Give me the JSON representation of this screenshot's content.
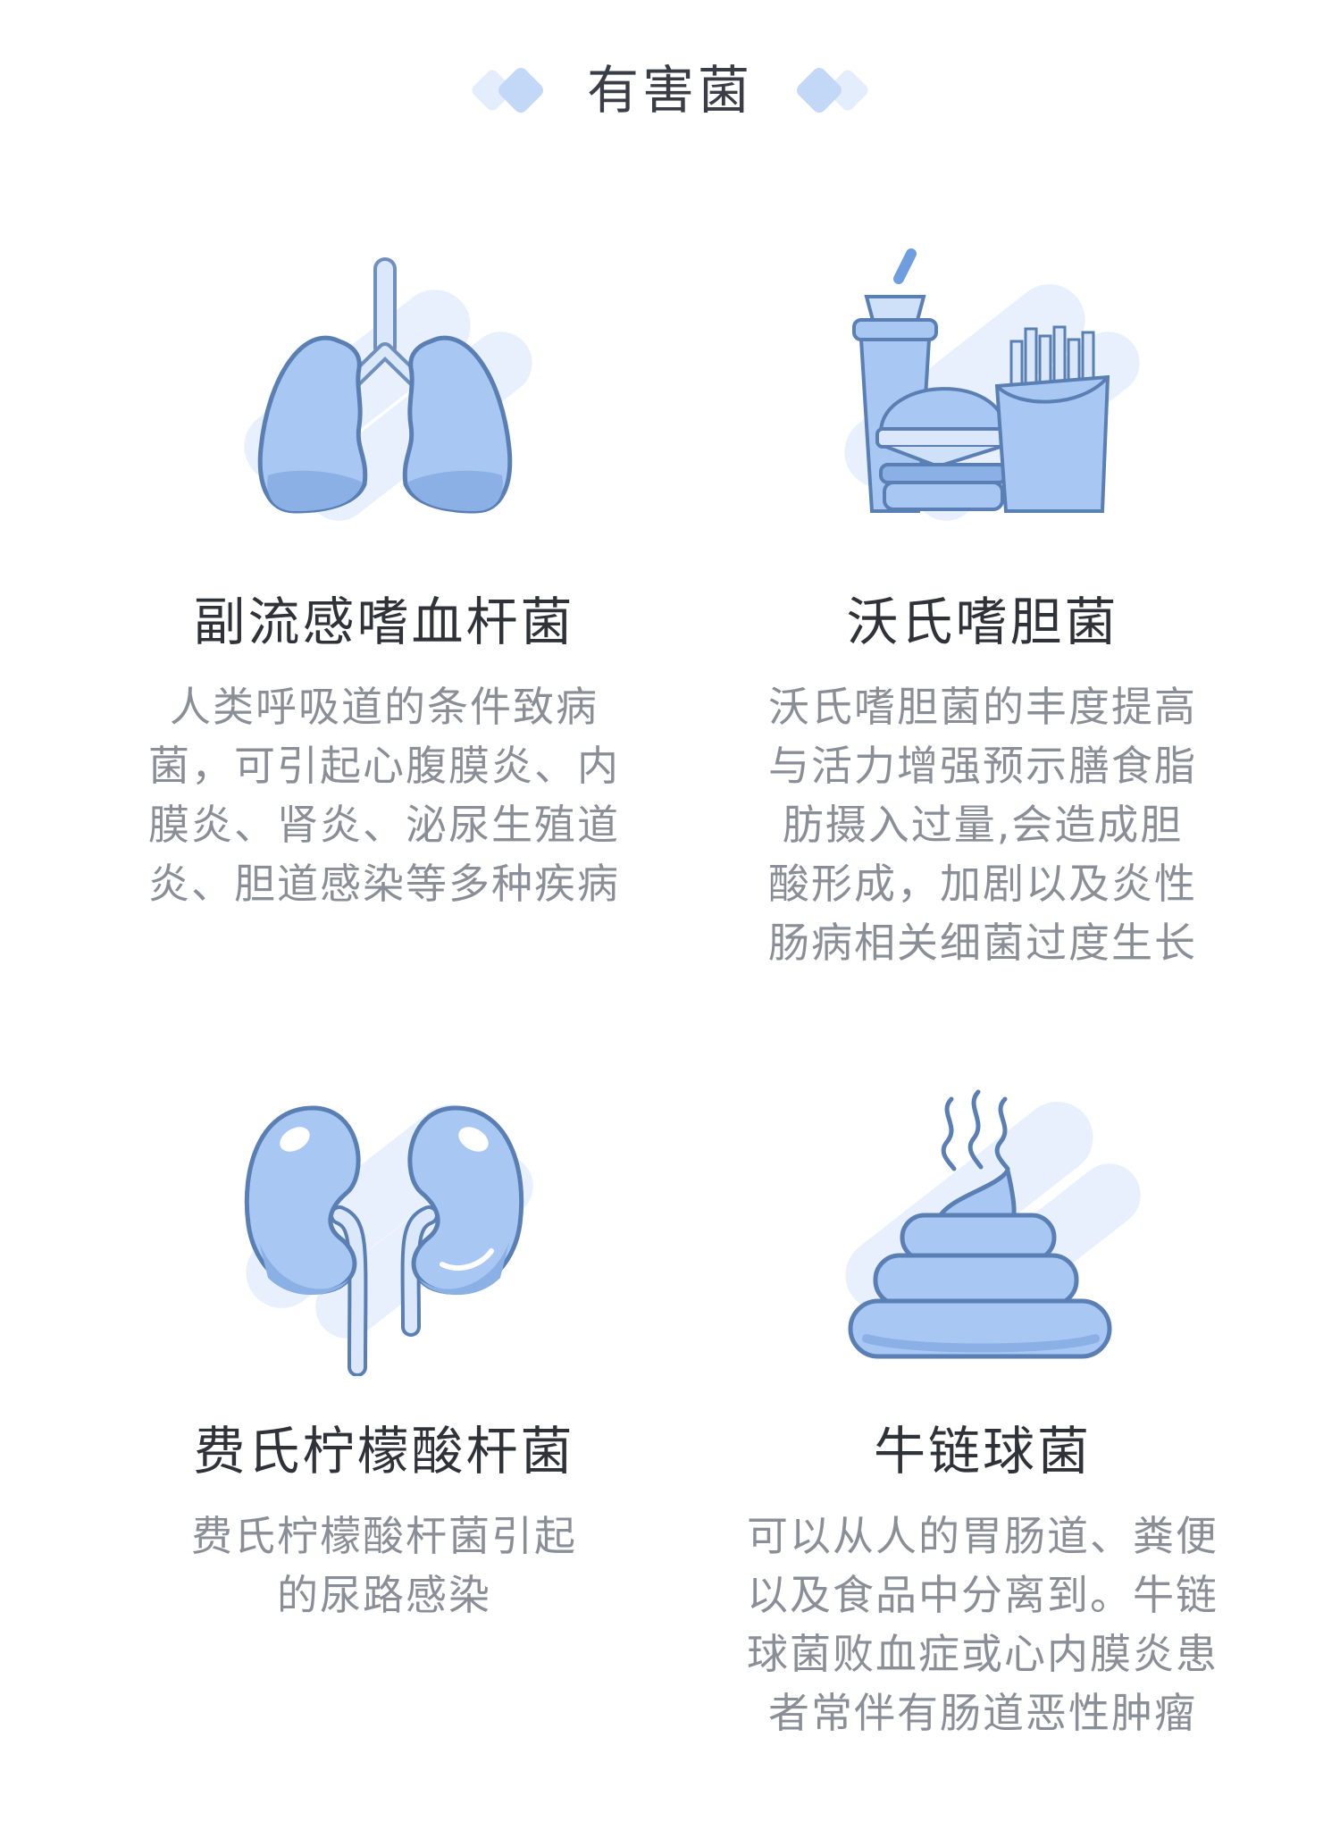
{
  "header": {
    "title": "有害菌"
  },
  "colors": {
    "accent_light": "#dde9fb",
    "accent_mid": "#a9c8f3",
    "accent": "#8fb6ee",
    "outline": "#5a7fb4"
  },
  "cards": [
    {
      "icon": "lungs-icon",
      "name": "副流感嗜血杆菌",
      "desc": [
        "人类呼吸道的条件致病",
        "菌，可引起心腹膜炎、内",
        "膜炎、肾炎、泌尿生殖道",
        "炎、胆道感染等多种疾病"
      ]
    },
    {
      "icon": "fast-food-icon",
      "name": "沃氏嗜胆菌",
      "desc": [
        "沃氏嗜胆菌的丰度提高",
        "与活力增强预示膳食脂",
        "肪摄入过量,会造成胆",
        "酸形成，加剧以及炎性",
        "肠病相关细菌过度生长"
      ]
    },
    {
      "icon": "kidneys-icon",
      "name": "费氏柠檬酸杆菌",
      "desc": [
        "费氏柠檬酸杆菌引起",
        "的尿路感染"
      ]
    },
    {
      "icon": "stool-icon",
      "name": "牛链球菌",
      "desc": [
        "可以从人的胃肠道、粪便",
        "以及食品中分离到。牛链",
        "球菌败血症或心内膜炎患",
        "者常伴有肠道恶性肿瘤"
      ]
    }
  ]
}
